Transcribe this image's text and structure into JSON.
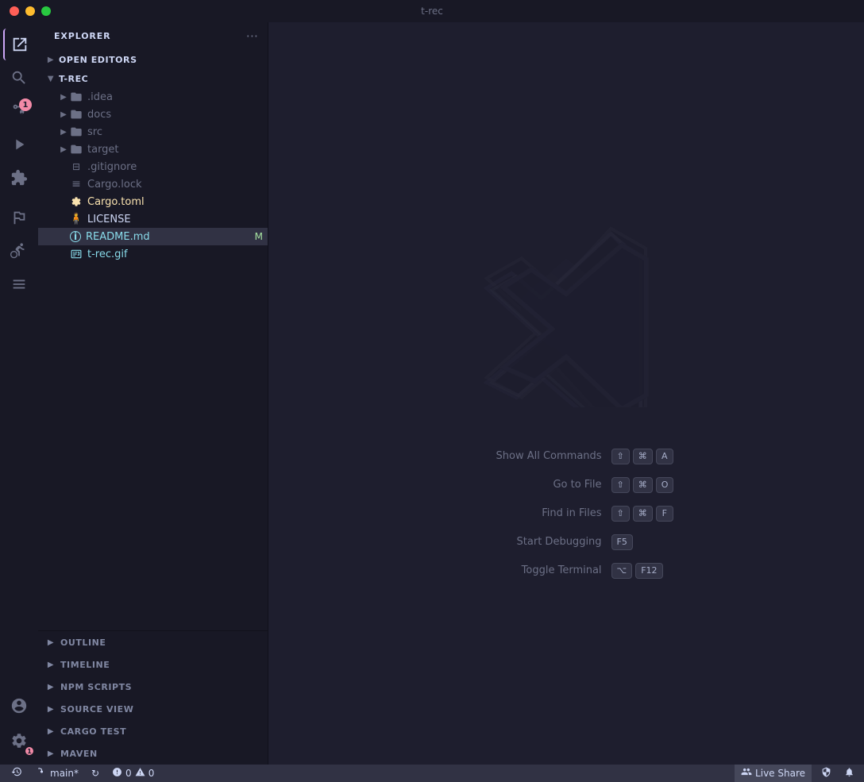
{
  "titlebar": {
    "title": "t-rec"
  },
  "activity_bar": {
    "icons": [
      {
        "name": "explorer-icon",
        "symbol": "⊞",
        "label": "Explorer",
        "active": true
      },
      {
        "name": "search-icon",
        "symbol": "🔍",
        "label": "Search",
        "active": false
      },
      {
        "name": "source-control-icon",
        "symbol": "⑂",
        "label": "Source Control",
        "active": false,
        "badge": "1"
      },
      {
        "name": "run-debug-icon",
        "symbol": "▷",
        "label": "Run and Debug",
        "active": false
      },
      {
        "name": "extensions-icon",
        "symbol": "⊞",
        "label": "Extensions",
        "active": false
      }
    ],
    "bottom_icons": [
      {
        "name": "remote-icon",
        "symbol": "⌂",
        "label": "Remote"
      },
      {
        "name": "account-icon",
        "symbol": "👤",
        "label": "Account"
      },
      {
        "name": "settings-icon",
        "symbol": "⚙",
        "label": "Settings",
        "badge": "1"
      }
    ]
  },
  "sidebar": {
    "header": "Explorer",
    "more_label": "···",
    "sections": {
      "open_editors": {
        "label": "OPEN EDITORS",
        "collapsed": true
      },
      "t_rec": {
        "label": "T-REC",
        "expanded": true,
        "items": [
          {
            "name": ".idea",
            "type": "folder",
            "icon": "📁",
            "color": "color-gray",
            "arrow": "▶"
          },
          {
            "name": "docs",
            "type": "folder",
            "icon": "📁",
            "color": "color-gray",
            "arrow": "▶"
          },
          {
            "name": "src",
            "type": "folder",
            "icon": "📁",
            "color": "color-gray",
            "arrow": "▶"
          },
          {
            "name": "target",
            "type": "folder",
            "icon": "📁",
            "color": "color-gray",
            "arrow": "▶"
          },
          {
            "name": ".gitignore",
            "type": "file",
            "icon": "⊟",
            "color": "color-gray"
          },
          {
            "name": "Cargo.lock",
            "type": "file",
            "icon": "≡",
            "color": "color-gray"
          },
          {
            "name": "Cargo.toml",
            "type": "file",
            "icon": "⚙",
            "color": "color-yellow"
          },
          {
            "name": "LICENSE",
            "type": "file",
            "icon": "🧍",
            "color": "color-yellow"
          },
          {
            "name": "README.md",
            "type": "file",
            "icon": "ℹ",
            "color": "color-cyan",
            "badge": "M",
            "highlighted": true
          },
          {
            "name": "t-rec.gif",
            "type": "file",
            "icon": "🖼",
            "color": "color-cyan"
          }
        ]
      }
    },
    "bottom_sections": [
      {
        "label": "OUTLINE",
        "arrow": "▶"
      },
      {
        "label": "TIMELINE",
        "arrow": "▶"
      },
      {
        "label": "NPM SCRIPTS",
        "arrow": "▶"
      },
      {
        "label": "SOURCE VIEW",
        "arrow": "▶"
      },
      {
        "label": "CARGO TEST",
        "arrow": "▶"
      },
      {
        "label": "MAVEN",
        "arrow": "▶"
      }
    ]
  },
  "editor": {
    "shortcuts": [
      {
        "label": "Show All Commands",
        "keys": [
          "⇧",
          "⌘",
          "A"
        ]
      },
      {
        "label": "Go to File",
        "keys": [
          "⇧",
          "⌘",
          "O"
        ]
      },
      {
        "label": "Find in Files",
        "keys": [
          "⇧",
          "⌘",
          "F"
        ]
      },
      {
        "label": "Start Debugging",
        "keys": [
          "F5"
        ]
      },
      {
        "label": "Toggle Terminal",
        "keys": [
          "⌥",
          "F12"
        ]
      }
    ]
  },
  "status_bar": {
    "branch": "main*",
    "sync_icon": "↻",
    "errors": "0",
    "warnings": "0",
    "live_share_icon": "👥",
    "live_share_label": "Live Share",
    "notification_icon": "🔔",
    "remote_icon": "⚙"
  }
}
